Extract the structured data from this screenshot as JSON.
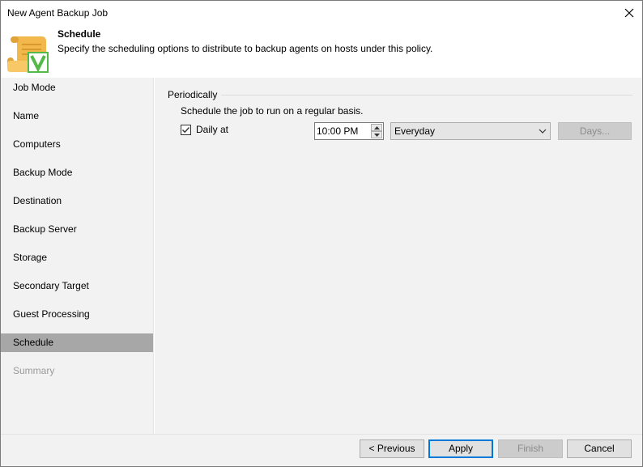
{
  "window": {
    "title": "New Agent Backup Job"
  },
  "header": {
    "title": "Schedule",
    "description": "Specify the scheduling options to distribute to backup agents on hosts under this policy.",
    "icon": "scroll-check-icon"
  },
  "sidebar": {
    "items": [
      {
        "label": "Job Mode",
        "state": "normal"
      },
      {
        "label": "Name",
        "state": "normal"
      },
      {
        "label": "Computers",
        "state": "normal"
      },
      {
        "label": "Backup Mode",
        "state": "normal"
      },
      {
        "label": "Destination",
        "state": "normal"
      },
      {
        "label": "Backup Server",
        "state": "normal"
      },
      {
        "label": "Storage",
        "state": "normal"
      },
      {
        "label": "Secondary Target",
        "state": "normal"
      },
      {
        "label": "Guest Processing",
        "state": "normal"
      },
      {
        "label": "Schedule",
        "state": "active"
      },
      {
        "label": "Summary",
        "state": "disabled"
      }
    ]
  },
  "main": {
    "group_label": "Periodically",
    "description": "Schedule the job to run on a regular basis.",
    "daily_checkbox": {
      "label": "Daily at",
      "checked": true
    },
    "time_value": "10:00 PM",
    "frequency_value": "Everyday",
    "days_button": "Days..."
  },
  "footer": {
    "previous": "< Previous",
    "apply": "Apply",
    "finish": "Finish",
    "cancel": "Cancel"
  },
  "colors": {
    "active_nav": "#a7a7a7",
    "panel_bg": "#f2f2f2",
    "focus_border": "#0078d7",
    "icon_scroll": "#f2b84b",
    "icon_check": "#54b948"
  }
}
